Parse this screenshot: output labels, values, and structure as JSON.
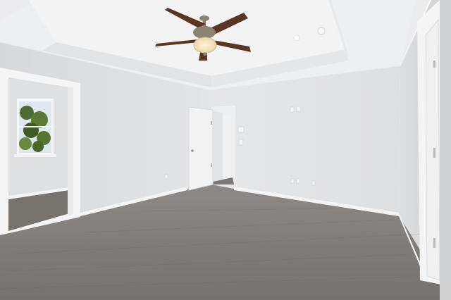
{
  "scene": {
    "description_label": "",
    "colors": {
      "ceiling": "#efeff0",
      "tray_ceiling": "#f4f4f5",
      "wall_back": "#e4e5e7",
      "wall_left": "#dcdddf",
      "wall_right": "#d9dadc",
      "carpet": "#7d7a78",
      "carpet_dark": "#6b6967",
      "trim": "#f6f6f6",
      "door": "#f2f2f3",
      "fan_blade": "#5a3522",
      "fan_metal": "#8d8373",
      "fan_light": "#f3e6c4",
      "window_foliage": "#4f6b2f",
      "window_sky": "#dfe7ee"
    },
    "icons": [
      "ceiling-fan-icon",
      "recessed-light-icon",
      "smoke-detector-icon",
      "outlet-icon",
      "light-switch-icon",
      "thermostat-icon",
      "door-hinge-icon"
    ]
  }
}
